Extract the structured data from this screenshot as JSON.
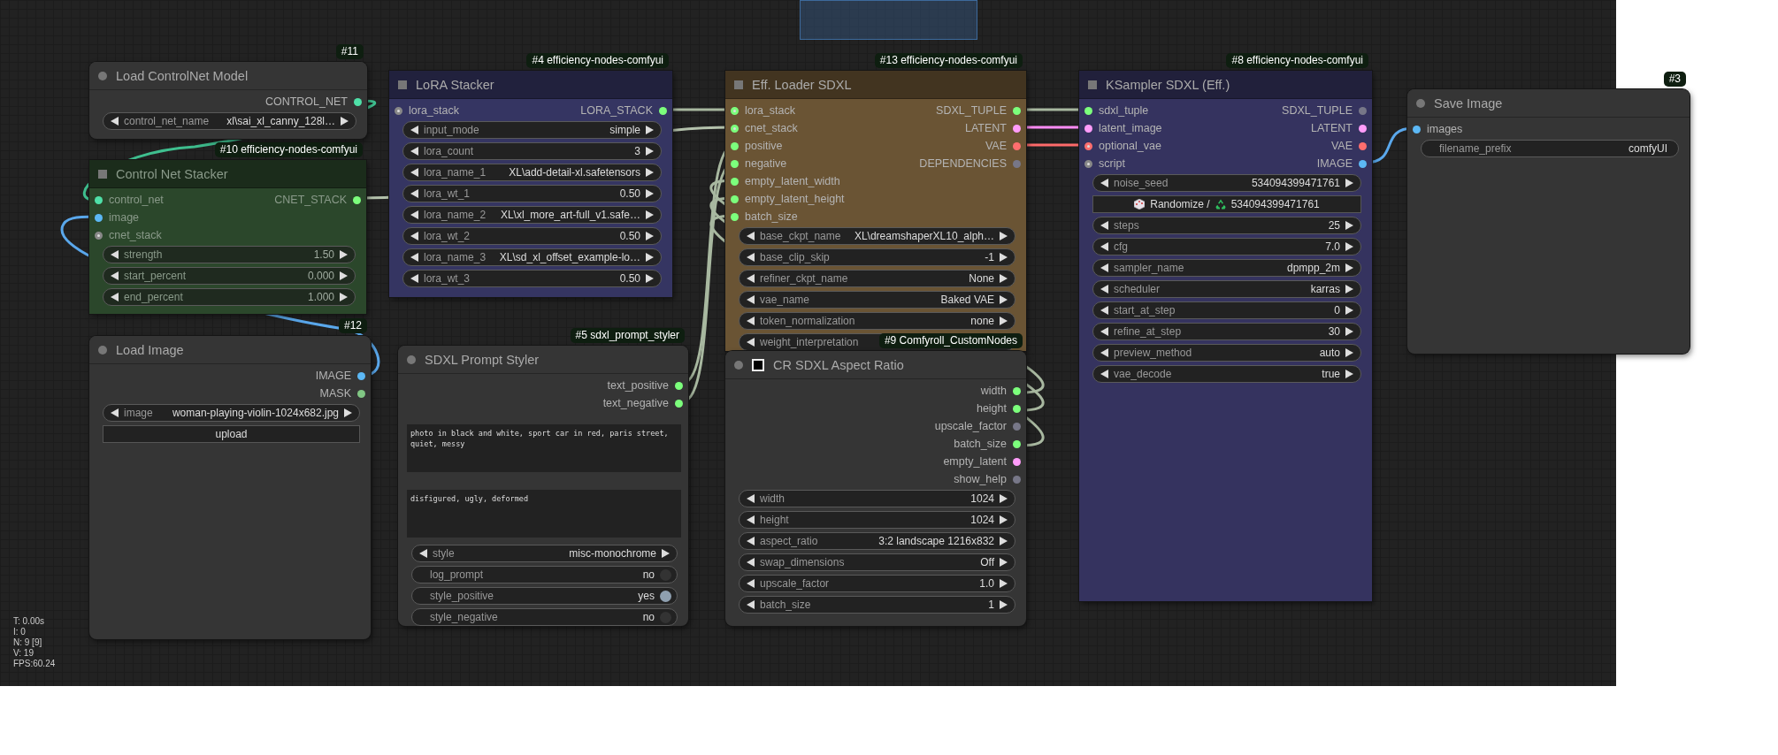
{
  "canvas": {
    "stats": [
      "T: 0.00s",
      "I: 0",
      "N: 9 [9]",
      "V: 19",
      "FPS:60.24"
    ]
  },
  "nodes": [
    {
      "badge": "#11",
      "title": "Load ControlNet Model",
      "kind": "standard",
      "color": "#353535",
      "muted": false,
      "outputs": [
        {
          "name": "CONTROL_NET",
          "color": "#4fe0a8",
          "hollow": false
        }
      ],
      "widgets": [
        {
          "kind": "combo",
          "name": "control_net_name",
          "value": "xl\\sai_xl_canny_128l…"
        }
      ]
    },
    {
      "badge": "#10 efficiency-nodes-comfyui",
      "title": "Control Net Stacker",
      "kind": "efficiency",
      "color": "#2b472b",
      "muted": true,
      "inputs": [
        {
          "name": "control_net",
          "color": "#4fe0a8",
          "hollow": false
        },
        {
          "name": "image",
          "color": "#5cb8f5",
          "hollow": false
        },
        {
          "name": "cnet_stack",
          "color": "#888888",
          "hollow": true
        }
      ],
      "outputs": [
        {
          "name": "CNET_STACK",
          "color": "#7cff7c",
          "hollow": false
        }
      ],
      "widgets": [
        {
          "kind": "combo",
          "name": "strength",
          "value": "1.50"
        },
        {
          "kind": "combo",
          "name": "start_percent",
          "value": "0.000"
        },
        {
          "kind": "combo",
          "name": "end_percent",
          "value": "1.000"
        }
      ]
    },
    {
      "badge": "#12",
      "title": "Load Image",
      "kind": "standard",
      "color": "#353535",
      "muted": false,
      "outputs": [
        {
          "name": "IMAGE",
          "color": "#5cb8f5",
          "hollow": false
        },
        {
          "name": "MASK",
          "color": "#81c784",
          "hollow": false
        }
      ],
      "widgets": [
        {
          "kind": "combo",
          "name": "image",
          "value": "woman-playing-violin-1024x682.jpg"
        },
        {
          "kind": "button",
          "label": "upload"
        }
      ]
    },
    {
      "badge": "#4 efficiency-nodes-comfyui",
      "title": "LoRA Stacker",
      "kind": "efficiency",
      "color": "#353562",
      "muted": false,
      "inputs": [
        {
          "name": "lora_stack",
          "color": "#888888",
          "hollow": true
        }
      ],
      "outputs": [
        {
          "name": "LORA_STACK",
          "color": "#7cff7c",
          "hollow": false
        }
      ],
      "widgets": [
        {
          "kind": "combo",
          "name": "input_mode",
          "value": "simple"
        },
        {
          "kind": "combo",
          "name": "lora_count",
          "value": "3"
        },
        {
          "kind": "combo",
          "name": "lora_name_1",
          "value": "XL\\add-detail-xl.safetensors"
        },
        {
          "kind": "combo",
          "name": "lora_wt_1",
          "value": "0.50"
        },
        {
          "kind": "combo",
          "name": "lora_name_2",
          "value": "XL\\xl_more_art-full_v1.safe…"
        },
        {
          "kind": "combo",
          "name": "lora_wt_2",
          "value": "0.50"
        },
        {
          "kind": "combo",
          "name": "lora_name_3",
          "value": "XL\\sd_xl_offset_example-lo…"
        },
        {
          "kind": "combo",
          "name": "lora_wt_3",
          "value": "0.50"
        }
      ]
    },
    {
      "badge": "#5 sdxl_prompt_styler",
      "title": "SDXL Prompt Styler",
      "kind": "standard",
      "color": "#353535",
      "muted": false,
      "outputs": [
        {
          "name": "text_positive",
          "color": "#7cff7c",
          "hollow": false
        },
        {
          "name": "text_negative",
          "color": "#7cff7c",
          "hollow": false
        }
      ],
      "widgets": [
        {
          "kind": "textarea",
          "value": "photo in black and white, sport car in red, paris street, quiet, messy"
        },
        {
          "kind": "textarea",
          "value": "disfigured, ugly, deformed"
        },
        {
          "kind": "combo",
          "name": "style",
          "value": "misc-monochrome"
        },
        {
          "kind": "toggle",
          "name": "log_prompt",
          "value": "no",
          "on": false
        },
        {
          "kind": "toggle",
          "name": "style_positive",
          "value": "yes",
          "on": true
        },
        {
          "kind": "toggle",
          "name": "style_negative",
          "value": "no",
          "on": false
        }
      ]
    },
    {
      "badge": "#13 efficiency-nodes-comfyui",
      "title": "Eff. Loader SDXL",
      "kind": "efficiency",
      "color": "#6a5434",
      "muted": false,
      "inputs": [
        {
          "name": "lora_stack",
          "color": "#7cff7c",
          "hollow": true
        },
        {
          "name": "cnet_stack",
          "color": "#7cff7c",
          "hollow": true
        },
        {
          "name": "positive",
          "color": "#7cff7c",
          "hollow": false
        },
        {
          "name": "negative",
          "color": "#7cff7c",
          "hollow": false
        },
        {
          "name": "empty_latent_width",
          "color": "#7cff7c",
          "hollow": false
        },
        {
          "name": "empty_latent_height",
          "color": "#7cff7c",
          "hollow": false
        },
        {
          "name": "batch_size",
          "color": "#7cff7c",
          "hollow": false
        }
      ],
      "outputs": [
        {
          "name": "SDXL_TUPLE",
          "color": "#7cff7c",
          "hollow": false
        },
        {
          "name": "LATENT",
          "color": "#ff9cf9",
          "hollow": false
        },
        {
          "name": "VAE",
          "color": "#ff6e6e",
          "hollow": false
        },
        {
          "name": "DEPENDENCIES",
          "color": "#777788",
          "hollow": false
        }
      ],
      "widgets": [
        {
          "kind": "combo",
          "name": "base_ckpt_name",
          "value": "XL\\dreamshaperXL10_alph…"
        },
        {
          "kind": "combo",
          "name": "base_clip_skip",
          "value": "-1"
        },
        {
          "kind": "combo",
          "name": "refiner_ckpt_name",
          "value": "None"
        },
        {
          "kind": "combo",
          "name": "vae_name",
          "value": "Baked VAE"
        },
        {
          "kind": "combo",
          "name": "token_normalization",
          "value": "none"
        },
        {
          "kind": "combo",
          "name": "weight_interpretation"
        }
      ]
    },
    {
      "badge": "#9 Comfyroll_CustomNodes",
      "title": "CR SDXL Aspect Ratio",
      "kind": "standard",
      "checkbox": {
        "checked": false
      },
      "color": "#353535",
      "muted": false,
      "outputs": [
        {
          "name": "width",
          "color": "#7cff7c",
          "hollow": false
        },
        {
          "name": "height",
          "color": "#7cff7c",
          "hollow": false
        },
        {
          "name": "upscale_factor",
          "color": "#777788",
          "hollow": false
        },
        {
          "name": "batch_size",
          "color": "#7cff7c",
          "hollow": false
        },
        {
          "name": "empty_latent",
          "color": "#ff9cf9",
          "hollow": false
        },
        {
          "name": "show_help",
          "color": "#777788",
          "hollow": false
        }
      ],
      "widgets": [
        {
          "kind": "combo",
          "name": "width",
          "value": "1024"
        },
        {
          "kind": "combo",
          "name": "height",
          "value": "1024"
        },
        {
          "kind": "combo",
          "name": "aspect_ratio",
          "value": "3:2 landscape 1216x832"
        },
        {
          "kind": "combo",
          "name": "swap_dimensions",
          "value": "Off"
        },
        {
          "kind": "combo",
          "name": "upscale_factor",
          "value": "1.0"
        },
        {
          "kind": "combo",
          "name": "batch_size",
          "value": "1"
        }
      ]
    },
    {
      "badge": "#8 efficiency-nodes-comfyui",
      "title": "KSampler SDXL (Eff.)",
      "kind": "efficiency",
      "color": "#35335f",
      "muted": false,
      "inputs": [
        {
          "name": "sdxl_tuple",
          "color": "#7cff7c",
          "hollow": false
        },
        {
          "name": "latent_image",
          "color": "#ff9cf9",
          "hollow": false
        },
        {
          "name": "optional_vae",
          "color": "#ff6e6e",
          "hollow": true
        },
        {
          "name": "script",
          "color": "#888888",
          "hollow": true
        }
      ],
      "outputs": [
        {
          "name": "SDXL_TUPLE",
          "color": "#777788",
          "hollow": false
        },
        {
          "name": "LATENT",
          "color": "#ff9cf9",
          "hollow": false
        },
        {
          "name": "VAE",
          "color": "#ff6e6e",
          "hollow": false
        },
        {
          "name": "IMAGE",
          "color": "#5cb8f5",
          "hollow": false
        }
      ],
      "widgets": [
        {
          "kind": "combo",
          "name": "noise_seed",
          "value": "534094399471761"
        },
        {
          "kind": "seed_button",
          "label": "Randomize /",
          "value": "534094399471761"
        },
        {
          "kind": "combo",
          "name": "steps",
          "value": "25"
        },
        {
          "kind": "combo",
          "name": "cfg",
          "value": "7.0"
        },
        {
          "kind": "combo",
          "name": "sampler_name",
          "value": "dpmpp_2m"
        },
        {
          "kind": "combo",
          "name": "scheduler",
          "value": "karras"
        },
        {
          "kind": "combo",
          "name": "start_at_step",
          "value": "0"
        },
        {
          "kind": "combo",
          "name": "refine_at_step",
          "value": "30"
        },
        {
          "kind": "combo",
          "name": "preview_method",
          "value": "auto"
        },
        {
          "kind": "combo",
          "name": "vae_decode",
          "value": "true"
        }
      ]
    },
    {
      "badge": "#3",
      "title": "Save Image",
      "kind": "standard",
      "color": "#353535",
      "muted": false,
      "inputs": [
        {
          "name": "images",
          "color": "#5cb8f5",
          "hollow": false
        }
      ],
      "widgets": [
        {
          "kind": "text_field",
          "name": "filename_prefix",
          "value": "comfyUI"
        }
      ]
    }
  ]
}
